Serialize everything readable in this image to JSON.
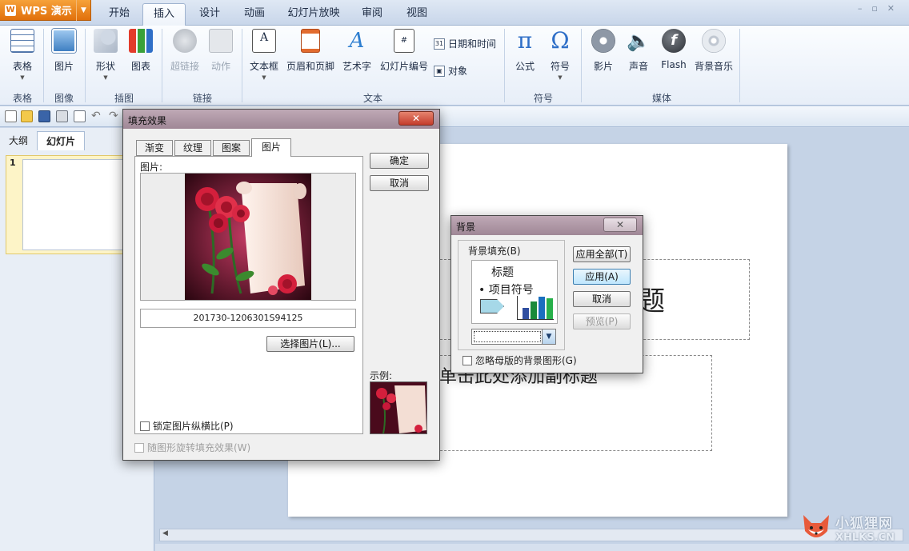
{
  "app": {
    "name": "WPS 演示"
  },
  "tabs": [
    "开始",
    "插入",
    "设计",
    "动画",
    "幻灯片放映",
    "审阅",
    "视图"
  ],
  "active_tab": "插入",
  "ribbon": {
    "buttons": {
      "table": "表格",
      "picture": "图片",
      "shape": "形状",
      "chart": "图表",
      "hyperlink": "超链接",
      "action": "动作",
      "textbox": "文本框",
      "header_footer": "页眉和页脚",
      "wordart": "艺术字",
      "slide_number": "幻灯片编号",
      "datetime": "日期和时间",
      "object": "对象",
      "formula": "公式",
      "symbol": "符号",
      "movie": "影片",
      "sound": "声音",
      "flash": "Flash",
      "bgmusic": "背景音乐"
    },
    "groups": {
      "table": "表格",
      "image": "图像",
      "illustration": "插图",
      "link": "链接",
      "text": "文本",
      "symbol": "符号",
      "media": "媒体"
    }
  },
  "left_panel": {
    "tab_outline": "大纲",
    "tab_slides": "幻灯片",
    "slide_number": "1"
  },
  "slide": {
    "title_tail": "题",
    "subtitle": "单击此处添加副标题"
  },
  "fill_dialog": {
    "title": "填充效果",
    "tabs": [
      "渐变",
      "纹理",
      "图案",
      "图片"
    ],
    "active_tab": "图片",
    "picture_label": "图片:",
    "filename": "201730-1206301S94125",
    "select_button": "选择图片(L)...",
    "ok": "确定",
    "cancel": "取消",
    "sample_label": "示例:",
    "lock_aspect": "锁定图片纵横比(P)",
    "rotate_with_shape": "随图形旋转填充效果(W)"
  },
  "bg_dialog": {
    "title": "背景",
    "fill_label": "背景填充(B)",
    "preview_title": "标题",
    "preview_bullet": "项目符号",
    "apply_all": "应用全部(T)",
    "apply": "应用(A)",
    "cancel": "取消",
    "preview_btn": "预览(P)",
    "ignore_master": "忽略母版的背景图形(G)"
  },
  "watermark": {
    "cn": "小狐狸网",
    "url": "XHLKS.CN"
  },
  "colors": {
    "accent": "#e1700b",
    "dialog_title": "#a9929f",
    "close": "#c43c2c"
  }
}
